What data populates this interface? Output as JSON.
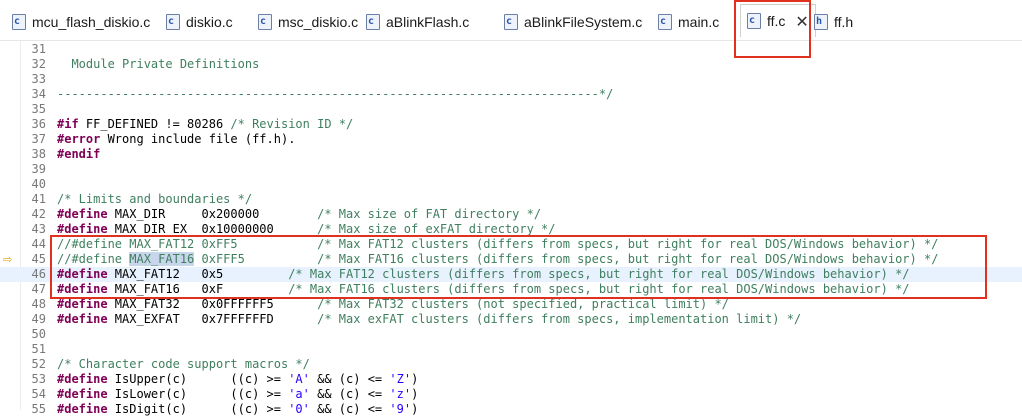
{
  "tabs": [
    {
      "label": "mcu_flash_diskio.c",
      "type": "c"
    },
    {
      "label": "diskio.c",
      "type": "c"
    },
    {
      "label": "msc_diskio.c",
      "type": "c"
    },
    {
      "label": "aBlinkFlash.c",
      "type": "c"
    },
    {
      "label": "aBlinkFileSystem.c",
      "type": "c"
    },
    {
      "label": "main.c",
      "type": "c"
    },
    {
      "label": "ff.c",
      "type": "c",
      "active": true,
      "close": "✕"
    },
    {
      "label": "ff.h",
      "type": "h"
    }
  ],
  "editor": {
    "current_line": "46",
    "lines": [
      {
        "n": "31",
        "segs": []
      },
      {
        "n": "32",
        "segs": [
          {
            "t": "  Module Private Definitions",
            "c": "cm"
          }
        ]
      },
      {
        "n": "33",
        "segs": []
      },
      {
        "n": "34",
        "segs": [
          {
            "t": "---------------------------------------------------------------------------*/",
            "c": "cm"
          }
        ]
      },
      {
        "n": "35",
        "segs": []
      },
      {
        "n": "36",
        "segs": [
          {
            "t": "#if",
            "c": "kw"
          },
          {
            "t": " FF_DEFINED != 80286 "
          },
          {
            "t": "/* Revision ID */",
            "c": "cm"
          }
        ]
      },
      {
        "n": "37",
        "segs": [
          {
            "t": "#error",
            "c": "kw"
          },
          {
            "t": " Wrong include file (ff.h)."
          }
        ]
      },
      {
        "n": "38",
        "segs": [
          {
            "t": "#endif",
            "c": "kw"
          }
        ]
      },
      {
        "n": "39",
        "segs": []
      },
      {
        "n": "40",
        "segs": []
      },
      {
        "n": "41",
        "segs": [
          {
            "t": "/* Limits and boundaries */",
            "c": "cm"
          }
        ]
      },
      {
        "n": "42",
        "segs": [
          {
            "t": "#define",
            "c": "kw"
          },
          {
            "t": " MAX_DIR     0x200000        "
          },
          {
            "t": "/* Max size of FAT directory */",
            "c": "cm"
          }
        ]
      },
      {
        "n": "43",
        "segs": [
          {
            "t": "#define",
            "c": "kw"
          },
          {
            "t": " MAX_DIR_EX  0x10000000      "
          },
          {
            "t": "/* Max size of exFAT directory */",
            "c": "cm"
          }
        ]
      },
      {
        "n": "44",
        "segs": [
          {
            "t": "//#define MAX_FAT12 0xFF5           /* Max FAT12 clusters (differs from specs, but right for real DOS/Windows behavior) */",
            "c": "cm"
          }
        ]
      },
      {
        "n": "45",
        "segs": [
          {
            "t": "//#define ",
            "c": "cm"
          },
          {
            "t": "MAX_FAT16",
            "c": "cm sel"
          },
          {
            "t": " 0xFFF5          /* Max FAT16 clusters (differs from specs, but right for real DOS/Windows behavior) */",
            "c": "cm"
          }
        ]
      },
      {
        "n": "46",
        "segs": [
          {
            "t": "#define",
            "c": "kw"
          },
          {
            "t": " MAX_FAT12   0x5         "
          },
          {
            "t": "/* Max FAT12 clusters (differs from specs, but right for real DOS/Windows behavior) */",
            "c": "cm"
          }
        ]
      },
      {
        "n": "47",
        "segs": [
          {
            "t": "#define",
            "c": "kw"
          },
          {
            "t": " MAX_FAT16   0xF         "
          },
          {
            "t": "/* Max FAT16 clusters (differs from specs, but right for real DOS/Windows behavior) */",
            "c": "cm"
          }
        ]
      },
      {
        "n": "48",
        "segs": [
          {
            "t": "#define",
            "c": "kw"
          },
          {
            "t": " MAX_FAT32   0x0FFFFFF5      "
          },
          {
            "t": "/* Max FAT32 clusters (not specified, practical limit) */",
            "c": "cm"
          }
        ]
      },
      {
        "n": "49",
        "segs": [
          {
            "t": "#define",
            "c": "kw"
          },
          {
            "t": " MAX_EXFAT   0x7FFFFFFD      "
          },
          {
            "t": "/* Max exFAT clusters (differs from specs, implementation limit) */",
            "c": "cm"
          }
        ]
      },
      {
        "n": "50",
        "segs": []
      },
      {
        "n": "51",
        "segs": []
      },
      {
        "n": "52",
        "segs": [
          {
            "t": "/* Character code support macros */",
            "c": "cm"
          }
        ]
      },
      {
        "n": "53",
        "segs": [
          {
            "t": "#define",
            "c": "kw"
          },
          {
            "t": " IsUpper(c)      ((c) >= "
          },
          {
            "t": "'A'",
            "c": "str"
          },
          {
            "t": " && (c) <= "
          },
          {
            "t": "'Z'",
            "c": "str"
          },
          {
            "t": ")"
          }
        ]
      },
      {
        "n": "54",
        "segs": [
          {
            "t": "#define",
            "c": "kw"
          },
          {
            "t": " IsLower(c)      ((c) >= "
          },
          {
            "t": "'a'",
            "c": "str"
          },
          {
            "t": " && (c) <= "
          },
          {
            "t": "'z'",
            "c": "str"
          },
          {
            "t": ")"
          }
        ]
      },
      {
        "n": "55",
        "segs": [
          {
            "t": "#define",
            "c": "kw"
          },
          {
            "t": " IsDigit(c)      ((c) >= "
          },
          {
            "t": "'0'",
            "c": "str"
          },
          {
            "t": " && (c) <= "
          },
          {
            "t": "'9'",
            "c": "str"
          },
          {
            "t": ")"
          }
        ]
      }
    ]
  }
}
